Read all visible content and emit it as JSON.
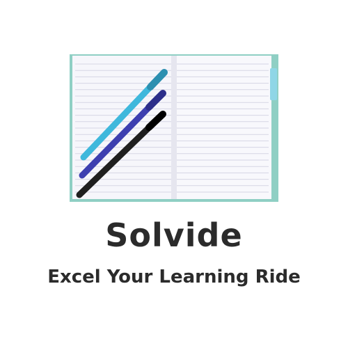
{
  "brand": {
    "name": "Solvide",
    "tagline": "Excel Your Learning Ride"
  },
  "illustration": {
    "subject": "open-notebook-with-pens",
    "colors": {
      "cover": "#8fcfc4",
      "paper": "#f6f6fb",
      "rule_line": "#d5d5e4",
      "bookmark": "#8fd6e6",
      "pen_cyan": "#3fb8dc",
      "pen_blue": "#3d3fb0",
      "pen_black": "#1f1f1f"
    }
  },
  "text_color": "#2b2b2b"
}
